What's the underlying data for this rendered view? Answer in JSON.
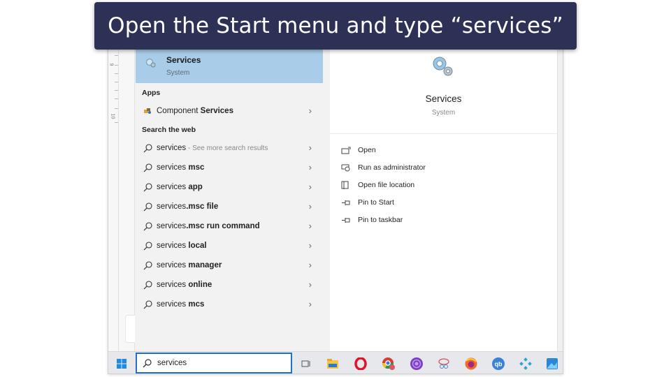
{
  "caption": "Open the Start menu and type “services”",
  "ruler": {
    "numbers": [
      "9",
      "10"
    ]
  },
  "best_match": {
    "title": "Services",
    "subtitle": "System",
    "icon": "services-gear-icon"
  },
  "apps_section": {
    "heading": "Apps",
    "items": [
      {
        "prefix": "Component ",
        "bold": "Services",
        "icon": "component-services-icon"
      }
    ]
  },
  "web_section": {
    "heading": "Search the web",
    "items": [
      {
        "prefix": "services",
        "bold": "",
        "hint": " - See more search results"
      },
      {
        "prefix": "services ",
        "bold": "msc",
        "hint": ""
      },
      {
        "prefix": "services ",
        "bold": "app",
        "hint": ""
      },
      {
        "prefix": "services",
        "bold": ".msc file",
        "hint": ""
      },
      {
        "prefix": "services",
        "bold": ".msc run command",
        "hint": ""
      },
      {
        "prefix": "services ",
        "bold": "local",
        "hint": ""
      },
      {
        "prefix": "services ",
        "bold": "manager",
        "hint": ""
      },
      {
        "prefix": "services ",
        "bold": "online",
        "hint": ""
      },
      {
        "prefix": "services ",
        "bold": "mcs",
        "hint": ""
      }
    ]
  },
  "detail": {
    "title": "Services",
    "subtitle": "System",
    "actions": [
      {
        "label": "Open",
        "icon": "open-icon"
      },
      {
        "label": "Run as administrator",
        "icon": "run-as-admin-icon"
      },
      {
        "label": "Open file location",
        "icon": "file-location-icon"
      },
      {
        "label": "Pin to Start",
        "icon": "pin-icon"
      },
      {
        "label": "Pin to taskbar",
        "icon": "pin-icon"
      }
    ]
  },
  "taskbar": {
    "search_value": "services",
    "apps": [
      "task-view",
      "file-explorer",
      "opera",
      "chrome",
      "tor-browser",
      "snipping-tool",
      "firefox",
      "qbittorrent",
      "kodi",
      "photos"
    ]
  },
  "colors": {
    "banner": "#2e3156",
    "highlight": "#a9cce8",
    "search_border": "#1e70c8"
  }
}
